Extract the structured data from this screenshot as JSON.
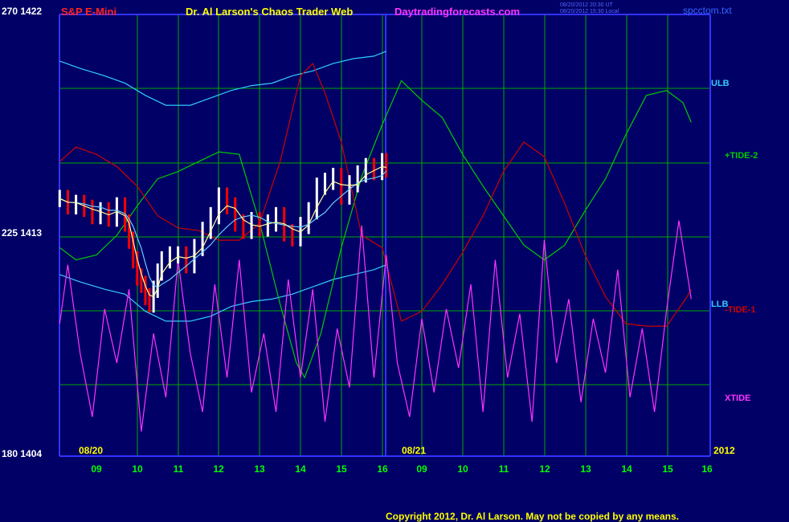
{
  "header": {
    "symbol": "S&P E-Mini",
    "title": "Dr. Al Larson's Chaos Trader Web",
    "site": "Daytradingforecasts.com",
    "timestamp_1": "08/20/2012 20:30 UT",
    "timestamp_2": "08/20/2012 15:30 Local",
    "file": "spcctom.txt"
  },
  "y_axis": {
    "top": "270  1422",
    "mid": "225  1413",
    "bottom": "180  1404"
  },
  "footer": {
    "copyright": "Copyright 2012, Dr. Al Larson. May not be copied by any means."
  },
  "colors": {
    "background": "#000066",
    "grid": "#00aa00",
    "axis": "#3333ff",
    "price_up": "#ffffff",
    "price_down": "#ff0000",
    "ulb": "#33ccff",
    "tide_plus": "#00cc00",
    "tide_minus": "#cc0000",
    "xtide": "#ff33ff",
    "ma_fast": "#ffff99",
    "ma_slow": "#66ccff",
    "hour_labels": "#00ff00",
    "date_labels": "#ffff00"
  },
  "chart_data": {
    "type": "line",
    "instrument": "S&P E-Mini",
    "y_scale": {
      "ylim": [
        1404,
        1422
      ],
      "oscillator_scale": [
        180,
        270
      ]
    },
    "x_hour_ticks": [
      "09",
      "10",
      "11",
      "12",
      "13",
      "14",
      "15",
      "16",
      "09",
      "10",
      "11",
      "12",
      "13",
      "14",
      "15",
      "16"
    ],
    "date_labels": [
      "08/20",
      "08/21",
      "2012"
    ],
    "series": [
      {
        "name": "ULB",
        "x": [
          8.1,
          8.6,
          9.2,
          9.7,
          10.2,
          10.7,
          11.3,
          11.8,
          12.3,
          12.8,
          13.3,
          13.8,
          14.3,
          14.8,
          15.3,
          15.8,
          16.1
        ],
        "y": [
          1420.1,
          1419.8,
          1419.5,
          1419.2,
          1418.7,
          1418.3,
          1418.3,
          1418.6,
          1418.9,
          1419.1,
          1419.2,
          1419.5,
          1419.7,
          1420.0,
          1420.2,
          1420.3,
          1420.5
        ]
      },
      {
        "name": "LLB",
        "x": [
          8.1,
          8.6,
          9.2,
          9.7,
          10.2,
          10.7,
          11.3,
          11.8,
          12.3,
          12.8,
          13.3,
          13.8,
          14.3,
          14.8,
          15.3,
          15.8,
          16.1
        ],
        "y": [
          1411.4,
          1411.1,
          1410.8,
          1410.6,
          1409.9,
          1409.5,
          1409.5,
          1409.7,
          1410.1,
          1410.3,
          1410.4,
          1410.6,
          1410.9,
          1411.2,
          1411.4,
          1411.6,
          1411.8
        ]
      },
      {
        "name": "+TIDE-2",
        "x": [
          8.1,
          8.5,
          9.0,
          9.5,
          10.0,
          10.5,
          11.0,
          11.5,
          12.0,
          12.5,
          13.0,
          13.5,
          13.9,
          14.1,
          14.5,
          15.0,
          15.5,
          16.0,
          16.5,
          17.0,
          17.5,
          18.0,
          18.5,
          19.0,
          19.5,
          20.0,
          20.5,
          21.0,
          21.5,
          22.0,
          22.5,
          23.0,
          23.4,
          23.6
        ],
        "y": [
          1412.5,
          1412.0,
          1412.2,
          1413.0,
          1414.2,
          1415.3,
          1415.6,
          1416.0,
          1416.4,
          1416.3,
          1413.5,
          1410.2,
          1407.8,
          1407.2,
          1409.0,
          1412.5,
          1415.4,
          1417.5,
          1419.3,
          1418.5,
          1417.8,
          1416.3,
          1415.0,
          1413.8,
          1412.6,
          1412.0,
          1412.6,
          1414.0,
          1415.3,
          1417.1,
          1418.7,
          1418.9,
          1418.4,
          1417.6
        ]
      },
      {
        "name": "-TIDE-1",
        "x": [
          8.1,
          8.5,
          9.0,
          9.5,
          10.0,
          10.5,
          11.0,
          11.5,
          12.0,
          12.5,
          13.0,
          13.5,
          14.0,
          14.3,
          14.6,
          15.0,
          15.5,
          16.0,
          16.5,
          17.0,
          17.5,
          18.0,
          18.5,
          19.0,
          19.5,
          20.0,
          20.5,
          21.0,
          21.5,
          22.0,
          22.5,
          23.0,
          23.5,
          23.6
        ],
        "y": [
          1416.0,
          1416.6,
          1416.3,
          1415.8,
          1415.0,
          1413.8,
          1413.3,
          1413.2,
          1412.8,
          1412.8,
          1413.5,
          1416.0,
          1419.5,
          1420.0,
          1418.8,
          1416.8,
          1413.0,
          1412.5,
          1409.5,
          1409.9,
          1411.0,
          1412.3,
          1413.8,
          1415.6,
          1416.8,
          1416.2,
          1414.3,
          1412.2,
          1410.5,
          1409.4,
          1409.3,
          1409.3,
          1410.5,
          1410.8
        ]
      },
      {
        "name": "XTIDE",
        "x": [
          8.1,
          8.3,
          8.6,
          8.9,
          9.2,
          9.5,
          9.8,
          10.1,
          10.4,
          10.7,
          11.0,
          11.3,
          11.6,
          11.9,
          12.2,
          12.5,
          12.8,
          13.1,
          13.4,
          13.7,
          14.0,
          14.3,
          14.6,
          14.9,
          15.2,
          15.5,
          15.8,
          16.1,
          16.4,
          16.7,
          17.0,
          17.3,
          17.6,
          17.9,
          18.2,
          18.5,
          18.8,
          19.1,
          19.4,
          19.7,
          20.0,
          20.3,
          20.6,
          20.9,
          21.2,
          21.5,
          21.8,
          22.1,
          22.4,
          22.7,
          23.0,
          23.3,
          23.6
        ],
        "y": [
          207,
          219,
          201,
          188,
          210,
          199,
          214,
          185,
          205,
          192,
          220,
          201,
          189,
          215,
          196,
          220,
          193,
          205,
          189,
          216,
          196,
          214,
          187,
          206,
          194,
          227,
          196,
          221,
          199,
          188,
          208,
          193,
          210,
          198,
          215,
          189,
          220,
          196,
          209,
          187,
          224,
          199,
          212,
          191,
          208,
          197,
          218,
          192,
          206,
          189,
          210,
          228,
          212
        ]
      },
      {
        "name": "Price",
        "x": [
          8.1,
          8.3,
          8.5,
          8.7,
          8.9,
          9.1,
          9.3,
          9.5,
          9.7,
          9.8,
          9.9,
          10.0,
          10.1,
          10.2,
          10.3,
          10.4,
          10.5,
          10.6,
          10.8,
          11.0,
          11.2,
          11.4,
          11.6,
          11.8,
          12.0,
          12.2,
          12.4,
          12.6,
          12.8,
          13.0,
          13.2,
          13.4,
          13.6,
          13.8,
          14.0,
          14.2,
          14.4,
          14.6,
          14.8,
          15.0,
          15.2,
          15.4,
          15.6,
          15.8,
          16.0,
          16.1
        ],
        "y": [
          1414.5,
          1414.2,
          1414.3,
          1414.1,
          1413.8,
          1414.0,
          1413.7,
          1414.2,
          1413.5,
          1412.8,
          1412.0,
          1411.3,
          1411.0,
          1410.5,
          1410.2,
          1410.8,
          1411.5,
          1412.0,
          1412.2,
          1412.2,
          1411.8,
          1412.5,
          1413.2,
          1413.8,
          1414.6,
          1414.2,
          1413.5,
          1413.2,
          1413.6,
          1413.3,
          1413.5,
          1413.8,
          1413.1,
          1412.9,
          1413.4,
          1414.0,
          1415.0,
          1415.2,
          1415.4,
          1414.6,
          1415.1,
          1415.5,
          1415.8,
          1415.6,
          1416.0,
          1415.7
        ]
      }
    ]
  }
}
